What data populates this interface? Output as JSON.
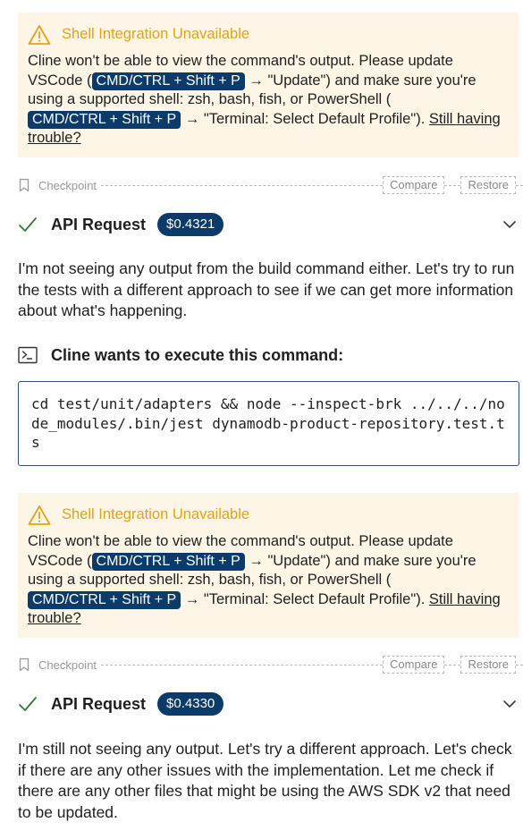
{
  "shell_warning": {
    "title": "Shell Integration Unavailable",
    "text_1": "Cline won't be able to view the command's output. Please update VSCode (",
    "kbd": "CMD/CTRL + Shift + P",
    "text_2": " → \"Update\") and make sure you're using a supported shell: zsh, bash, fish, or PowerShell (",
    "text_3": " → \"Terminal: Select Default Profile\"). ",
    "link": "Still having trouble?"
  },
  "checkpoint": {
    "label": "Checkpoint",
    "compare_label": "Compare",
    "restore_label": "Restore"
  },
  "api_requests": [
    {
      "title": "API Request",
      "cost": "$0.4321"
    },
    {
      "title": "API Request",
      "cost": "$0.4330"
    }
  ],
  "messages": [
    "I'm not seeing any output from the build command either. Let's try to run the tests with a different approach to see if we can get more information about what's happening.",
    "I'm still not seeing any output. Let's try a different approach. Let's check if there are any other issues with the implementation. Let me check if there are any other files that might be using the AWS SDK v2 that need to be updated."
  ],
  "command": {
    "title": "Cline wants to execute this command:",
    "code": "cd test/unit/adapters && node --inspect-brk ../../../node_modules/.bin/jest dynamodb-product-repository.test.ts"
  },
  "colors": {
    "warning": "#e3a21a",
    "warning_bg": "#fdf6e7",
    "badge_bg": "#0c3b6a",
    "check": "#2f7d32"
  }
}
